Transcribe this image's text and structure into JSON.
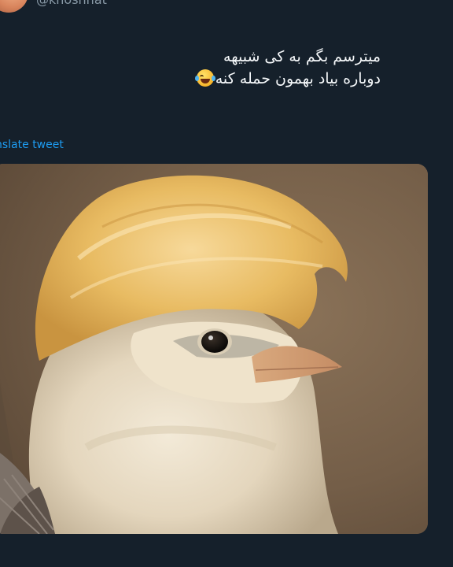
{
  "user": {
    "handle": "@khoshhat"
  },
  "tweet": {
    "line1": "میترسم بگم به کی شبیهه",
    "line2": "دوباره بیاد بهمون حمله کنه",
    "emoji": "laughing-with-tears"
  },
  "actions": {
    "translate_label": "nslate tweet"
  },
  "media": {
    "subject": "bird-with-blonde-hair"
  },
  "colors": {
    "background": "#15202b",
    "text": "#f5f8fa",
    "muted": "#8899a6",
    "link": "#1d9bf0"
  }
}
